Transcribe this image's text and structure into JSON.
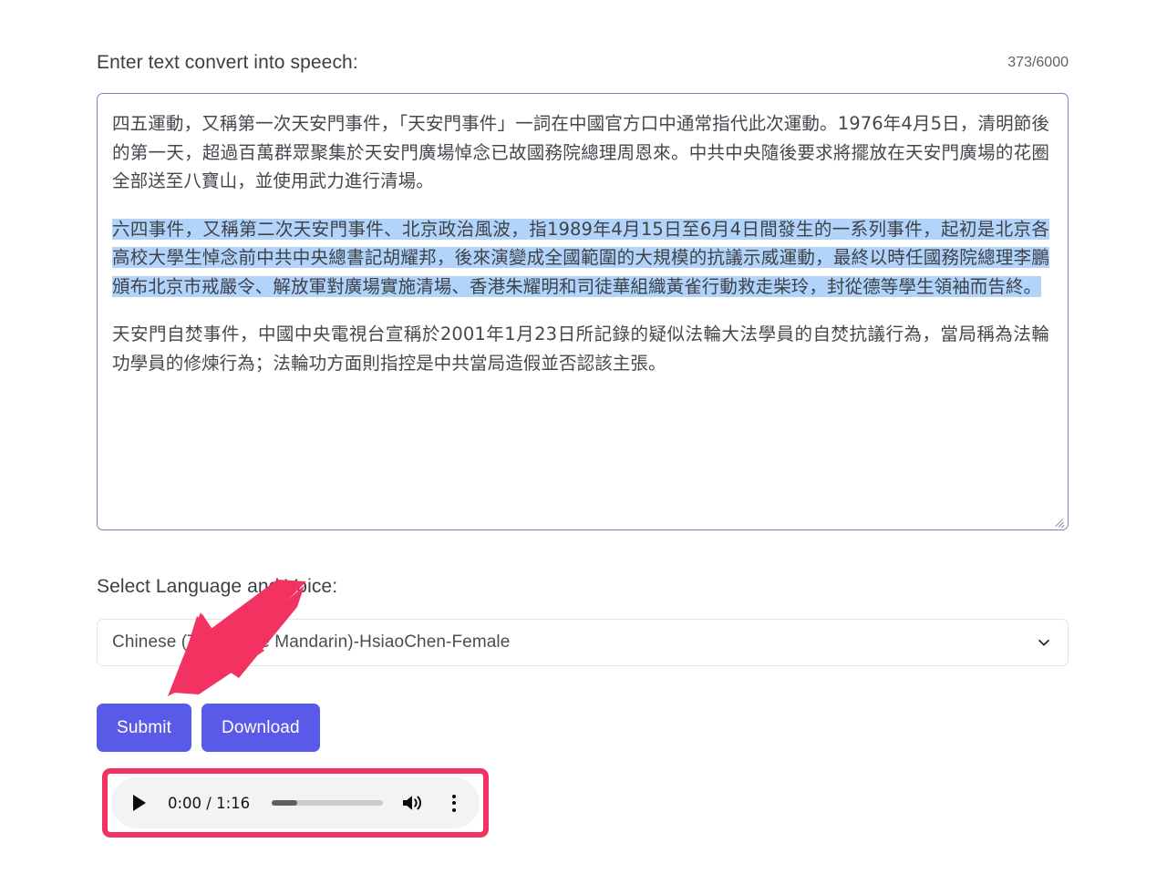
{
  "form": {
    "text_label": "Enter text convert into speech:",
    "char_counter": "373/6000",
    "textarea": {
      "paragraph_1": "四五運動，又稱第一次天安門事件，「天安門事件」一詞在中國官方口中通常指代此次運動。1976年4月5日，清明節後的第一天，超過百萬群眾聚集於天安門廣場悼念已故國務院總理周恩來。中共中央隨後要求將擺放在天安門廣場的花圈全部送至八寶山，並使用武力進行清場。",
      "paragraph_2": "六四事件，又稱第二次天安門事件、北京政治風波，指1989年4月15日至6月4日間發生的一系列事件，起初是北京各高校大學生悼念前中共中央總書記胡耀邦，後來演變成全國範圍的大規模的抗議示威運動，最終以時任國務院總理李鵬頒布北京市戒嚴令、解放軍對廣場實施清場、香港朱耀明和司徒華組織黃雀行動救走柴玲，封從德等學生領袖而告終。",
      "paragraph_3": "天安門自焚事件，中國中央電視台宣稱於2001年1月23日所記錄的疑似法輪大法學員的自焚抗議行為，當局稱為法輪功學員的修煉行為；法輪功方面則指控是中共當局造假並否認該主張。",
      "selected_paragraph_index": 2
    },
    "voice_label": "Select Language and Voice:",
    "voice_selected": "Chinese (Taiwanese Mandarin)-HsiaoChen-Female",
    "submit_label": "Submit",
    "download_label": "Download"
  },
  "audio": {
    "current_time": "0:00",
    "duration": "1:16",
    "time_display": "0:00 / 1:16",
    "progress_percent": 23,
    "play_icon": "play-icon",
    "volume_icon": "volume-icon",
    "menu_icon": "more-vertical-icon"
  },
  "icons": {
    "chevron_down": "chevron-down-icon",
    "resize_grip": "resize-handle-icon",
    "annotation_arrow": "red-arrow-annotation"
  },
  "colors": {
    "button_primary": "#5a5ae8",
    "textarea_border": "#7b7fc4",
    "selection_highlight": "#b2d4fb",
    "annotation_red": "#f23361",
    "audio_bg": "#f1f3f4",
    "text_primary": "#3c4043"
  }
}
